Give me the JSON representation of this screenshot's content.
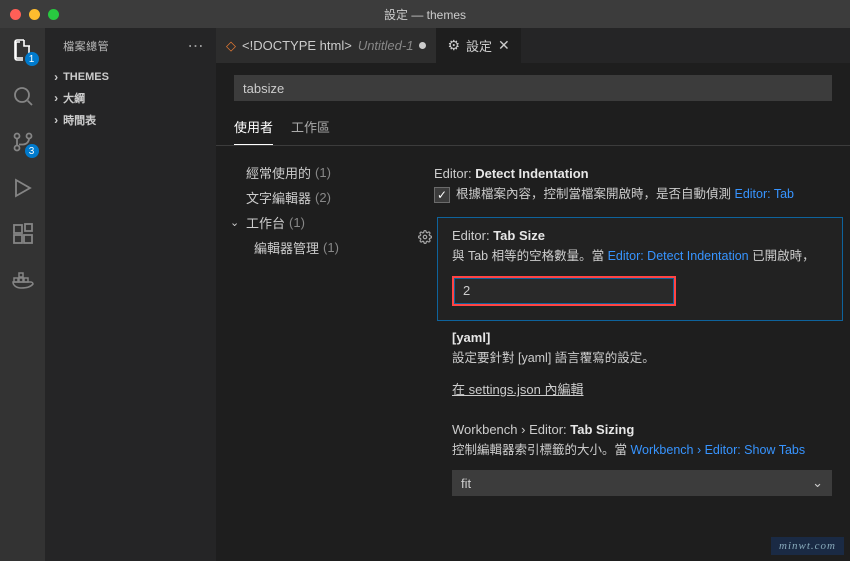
{
  "window": {
    "title": "設定 — themes"
  },
  "activity": {
    "explorer_badge": "1",
    "scm_badge": "3"
  },
  "sidebar": {
    "title": "檔案總管",
    "sections": [
      {
        "label": "THEMES"
      },
      {
        "label": "大綱"
      },
      {
        "label": "時間表"
      }
    ]
  },
  "tabs": {
    "file": {
      "label": "<!DOCTYPE html>",
      "sublabel": "Untitled-1"
    },
    "settings": {
      "label": "設定"
    }
  },
  "settings": {
    "search_value": "tabsize",
    "scope_tabs": {
      "user": "使用者",
      "workspace": "工作區"
    },
    "toc": {
      "common": {
        "label": "經常使用的",
        "count": "(1)"
      },
      "text": {
        "label": "文字編輯器",
        "count": "(2)"
      },
      "workbench": {
        "label": "工作台",
        "count": "(1)"
      },
      "editor_mgmt": {
        "label": "編輯器管理",
        "count": "(1)"
      }
    },
    "items": {
      "detect_indent": {
        "prefix": "Editor:",
        "name": "Detect Indentation",
        "desc_a": "根據檔案內容，控制當檔案開啟時，是否自動偵測 ",
        "link_a": "Editor: Tab"
      },
      "tab_size": {
        "prefix": "Editor:",
        "name": "Tab Size",
        "desc_a": "與 Tab 相等的空格數量。當 ",
        "link_a": "Editor: Detect Indentation",
        "desc_b": " 已開啟時，",
        "value": "2"
      },
      "yaml": {
        "heading": "[yaml]",
        "desc": "設定要針對 [yaml] 語言覆寫的設定。",
        "link": "在 settings.json 內編輯"
      },
      "tab_sizing": {
        "prefix": "Workbench › Editor:",
        "name": "Tab Sizing",
        "desc_a": "控制編輯器索引標籤的大小。當 ",
        "link_a": "Workbench › Editor: Show Tabs",
        "value": "fit"
      }
    }
  },
  "watermark": "minwt.com"
}
